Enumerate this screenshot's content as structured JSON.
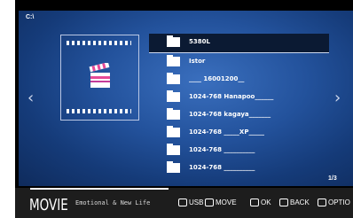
{
  "path": "C:\\",
  "files": [
    {
      "name": "5380L",
      "selected": true
    },
    {
      "name": "Istor",
      "selected": false
    },
    {
      "name": "____  16001200__",
      "selected": false
    },
    {
      "name": "1024-768  Hanapoo______",
      "selected": false
    },
    {
      "name": "1024-768  kagaya_______",
      "selected": false
    },
    {
      "name": "1024-768  _____XP_____",
      "selected": false
    },
    {
      "name": "1024-768  __________",
      "selected": false
    },
    {
      "name": "1024-768  __________",
      "selected": false
    }
  ],
  "page_indicator": "1/3",
  "bottom_bar": {
    "title": "MOVIE",
    "subtitle": "Emotional & New Life",
    "hints": {
      "usb": "USB",
      "move": "MOVE",
      "ok": "OK",
      "back": "BACK",
      "option": "OPTIO"
    }
  },
  "progress": 0.41,
  "icons": {
    "folder": "folder-icon",
    "clapper": "clapperboard-icon",
    "left": "chevron-left-icon",
    "right": "chevron-right-icon"
  },
  "colors": {
    "viewport": "#23529c",
    "selected_row": "#0b1a33",
    "bar": "#1d1d1d"
  }
}
